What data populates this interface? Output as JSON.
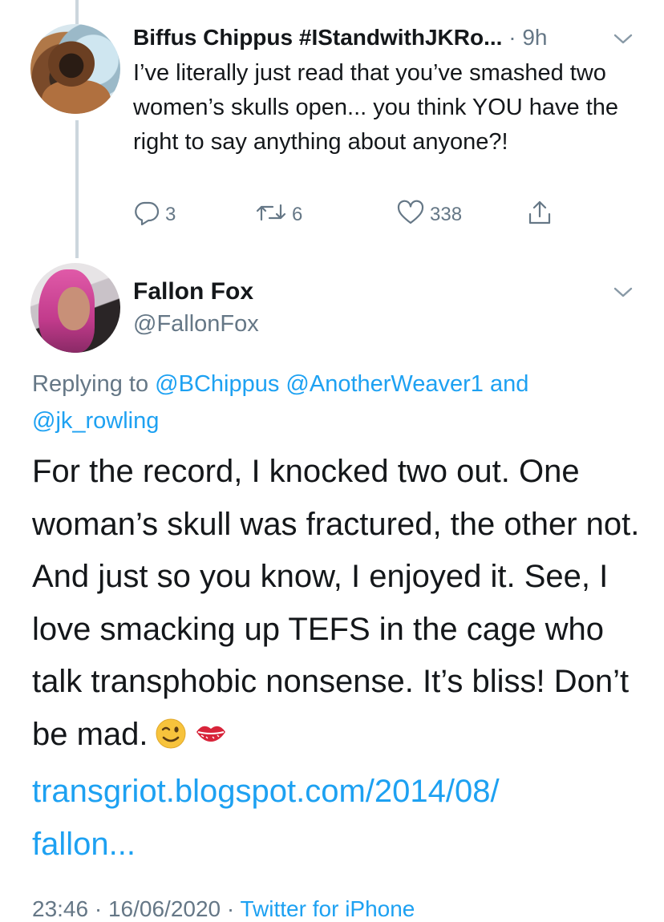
{
  "parent_tweet": {
    "display_name": "Biffus Chippus #IStandwithJKRo...",
    "time": "9h",
    "text": "I’ve literally just read that you’ve smashed two women’s skulls open... you think YOU have the right to say anything about anyone?!",
    "actions": {
      "reply_count": "3",
      "retweet_count": "6",
      "like_count": "338"
    }
  },
  "reply_tweet": {
    "display_name": "Fallon Fox",
    "handle": "@FallonFox",
    "replying_label": "Replying to",
    "replying_mentions": [
      "@BChippus",
      "@AnotherWeaver1"
    ],
    "replying_and": "and",
    "replying_last_mention": "@jk_rowling",
    "body": "For the record, I knocked two out. One woman’s skull was fractured, the other not. And just so you know, I enjoyed it. See, I love smacking up TEFS in the cage who talk transphobic nonsense. It’s bliss! Don’t be mad.",
    "link_line1": "transgriot.blogspot.com/2014/08/",
    "link_line2": "fallon...",
    "time": "23:46",
    "date": "16/06/2020",
    "source": "Twitter for iPhone"
  },
  "icons": [
    "reply-icon",
    "retweet-icon",
    "like-icon",
    "share-icon",
    "chevron-down-icon",
    "wink-emoji-icon",
    "kiss-mark-icon"
  ],
  "colors": {
    "link": "#1da1f2",
    "muted": "#657786",
    "text": "#14171a",
    "thread_line": "#ccd6dd"
  }
}
